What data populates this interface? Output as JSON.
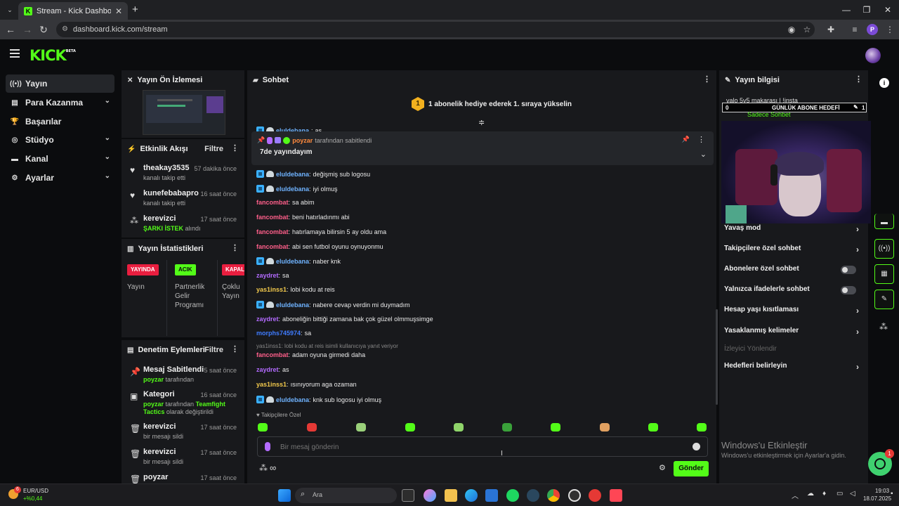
{
  "browser": {
    "tab_title": "Stream - Kick Dashboard",
    "tab_close": "✕",
    "new_tab": "+",
    "url": "dashboard.kick.com/stream",
    "profile_letter": "P"
  },
  "header": {
    "logo": "KICK",
    "logo_beta": "BETA"
  },
  "sidebar": {
    "items": [
      {
        "label": "Yayın",
        "icon": "broadcast-icon",
        "glyph": "((•))",
        "active": true
      },
      {
        "label": "Para Kazanma",
        "icon": "money-icon",
        "glyph": "▤",
        "chevron": true
      },
      {
        "label": "Başarılar",
        "icon": "trophy-icon",
        "glyph": "🏆"
      },
      {
        "label": "Stüdyo",
        "icon": "studio-icon",
        "glyph": "◎",
        "chevron": true
      },
      {
        "label": "Kanal",
        "icon": "channel-icon",
        "glyph": "▬",
        "chevron": true
      },
      {
        "label": "Ayarlar",
        "icon": "gear-icon",
        "glyph": "⚙",
        "chevron": true
      }
    ]
  },
  "preview": {
    "title": "Yayın Ön İzlemesi"
  },
  "activity": {
    "title": "Etkinlik Akışı",
    "filter": "Filtre",
    "items": [
      {
        "name": "theakay3535",
        "sub": "kanalı takip etti",
        "time": "57 dakika önce",
        "icon": "heart-icon",
        "glyph": "♥"
      },
      {
        "name": "kunefebabapro",
        "sub": "kanalı takip etti",
        "time": "16 saat önce",
        "icon": "heart-icon",
        "glyph": "♥"
      },
      {
        "name": "kerevizci",
        "sub_green": "ŞARKI İSTEK",
        "sub_rest": " alındı",
        "time": "17 saat önce",
        "icon": "kick-points-icon",
        "glyph": "⁂"
      }
    ]
  },
  "stats": {
    "title": "Yayın İstatistikleri",
    "cols": [
      {
        "badge": "YAYINDA",
        "label": "Yayın",
        "badge_color": "#e91e3f",
        "badge_text_color": "#ffffff"
      },
      {
        "badge": "ACIK",
        "label": "Partnerlik Gelir Programı",
        "badge_color": "#53fc18",
        "badge_text_color": "#0b0c0e"
      },
      {
        "badge": "KAPALI",
        "label": "Çoklu Yayın",
        "badge_color": "#e91e3f",
        "badge_text_color": "#ffffff"
      }
    ]
  },
  "mod_actions": {
    "title": "Denetim Eylemleri",
    "filter": "Filtre",
    "items": [
      {
        "name": "Mesaj Sabitlendi",
        "sub_green": "poyzar",
        "sub_rest": " tarafından",
        "time": "5 saat önce",
        "icon": "pin-icon",
        "glyph": "📌"
      },
      {
        "name": "Kategori",
        "sub_green": "poyzar",
        "sub_rest": " tarafından ",
        "sub_green2": "Teamfight",
        "sub_line2_green": "Tactics",
        "sub_line2_rest": " olarak değiştirildi",
        "time": "16 saat önce",
        "icon": "category-icon",
        "glyph": "▣"
      },
      {
        "name": "kerevizci",
        "sub_rest": "bir mesajı sildi",
        "time": "17 saat önce",
        "icon": "trash-icon",
        "glyph": "🗑"
      },
      {
        "name": "kerevizci",
        "sub_rest": "bir mesajı sildi",
        "time": "17 saat önce",
        "icon": "trash-icon",
        "glyph": "🗑"
      },
      {
        "name": "poyzar",
        "sub_rest": "",
        "time": "17 saat önce",
        "icon": "trash-icon",
        "glyph": "🗑"
      }
    ]
  },
  "chat": {
    "title": "Sohbet",
    "gift_banner": "1 abonelik hediye ederek 1. sıraya yükselin",
    "gift_rank": "1",
    "partial_top": {
      "user": "eluldebana",
      "text": "as"
    },
    "pinned": {
      "by_user": "poyzar",
      "by_suffix": "tarafından sabitlendi",
      "text": "7de yayındayım"
    },
    "messages": [
      {
        "user": "eluldebana",
        "color": "#6fb3ff",
        "badges": true,
        "text": "değişmiş sub logosu"
      },
      {
        "user": "eluldebana",
        "color": "#6fb3ff",
        "badges": true,
        "text": "iyi olmuş"
      },
      {
        "user": "fancombat",
        "color": "#ff5f8a",
        "text": "sa abim"
      },
      {
        "user": "fancombat",
        "color": "#ff5f8a",
        "text": "beni hatırladınmı abi"
      },
      {
        "user": "fancombat",
        "color": "#ff5f8a",
        "text": "hatırlamaya bilirsin 5 ay oldu ama"
      },
      {
        "user": "fancombat",
        "color": "#ff5f8a",
        "text": "abi sen futbol oyunu oynuyonmu"
      },
      {
        "user": "eluldebana",
        "color": "#6fb3ff",
        "badges": true,
        "text": "naber knk"
      },
      {
        "user": "zaydret",
        "color": "#b36bff",
        "text": "sa"
      },
      {
        "user": "yas1inss1",
        "color": "#f2c94c",
        "text": "lobi kodu at reis"
      },
      {
        "user": "eluldebana",
        "color": "#6fb3ff",
        "badges": true,
        "text": "nabere cevap verdin mi duymadım"
      },
      {
        "user": "zaydret",
        "color": "#b36bff",
        "text": "aboneliğin bittiği zamana bak çok güzel olmmuşsimge"
      },
      {
        "user": "morphs745974",
        "color": "#3f7cff",
        "text": "sa"
      },
      {
        "user": "fancombat",
        "color": "#ff5f8a",
        "text": "adam oyuna girmedi daha",
        "reply": "yas1inss1: lobi kodu at reis isimli kullanıcıya yanıt veriyor"
      },
      {
        "user": "zaydret",
        "color": "#b36bff",
        "text": "as"
      },
      {
        "user": "yas1inss1",
        "color": "#f2c94c",
        "text": "ısınıyorum aga ozaman"
      },
      {
        "user": "eluldebana",
        "color": "#6fb3ff",
        "badges": true,
        "text": "knk sub logosu iyi olmuş"
      }
    ],
    "emote_section": "Takipçilere Özel",
    "input_placeholder": "Bir mesaj gönderin",
    "send_label": "Gönder"
  },
  "stream_info": {
    "title": "Yayın bilgisi",
    "stream_title": "valo 5v5 makarası | !insta",
    "sub_only_tag": "Sadece Sohbet",
    "goal_label": "GÜNLÜK ABONE HEDEFİ",
    "goal_current": "0",
    "goal_target": "1",
    "options": [
      {
        "label": "Yavaş mod",
        "type": "chevron"
      },
      {
        "label": "Takipçilere özel sohbet",
        "type": "chevron"
      },
      {
        "label": "Abonelere özel sohbet",
        "type": "toggle"
      },
      {
        "label": "Yalnızca ifadelerle sohbet",
        "type": "toggle"
      },
      {
        "label": "Hesap yaşı kısıtlaması",
        "type": "chevron"
      },
      {
        "label": "Yasaklanmış kelimeler",
        "type": "chevron"
      },
      {
        "label": "İzleyici Yönlendir",
        "type": "disabled"
      },
      {
        "label": "Hedefleri belirleyin",
        "type": "chevron"
      }
    ]
  },
  "windows_activation": {
    "title": "Windows'u Etkinleştir",
    "sub": "Windows'u etkinleştirmek için Ayarlar'a gidin."
  },
  "support_badge": "1",
  "taskbar": {
    "weather_badge": "6",
    "ticker_name": "EUR/USD",
    "ticker_change": "+%0,44",
    "search": "Ara",
    "time": "19:03",
    "date": "18.07.2025"
  }
}
